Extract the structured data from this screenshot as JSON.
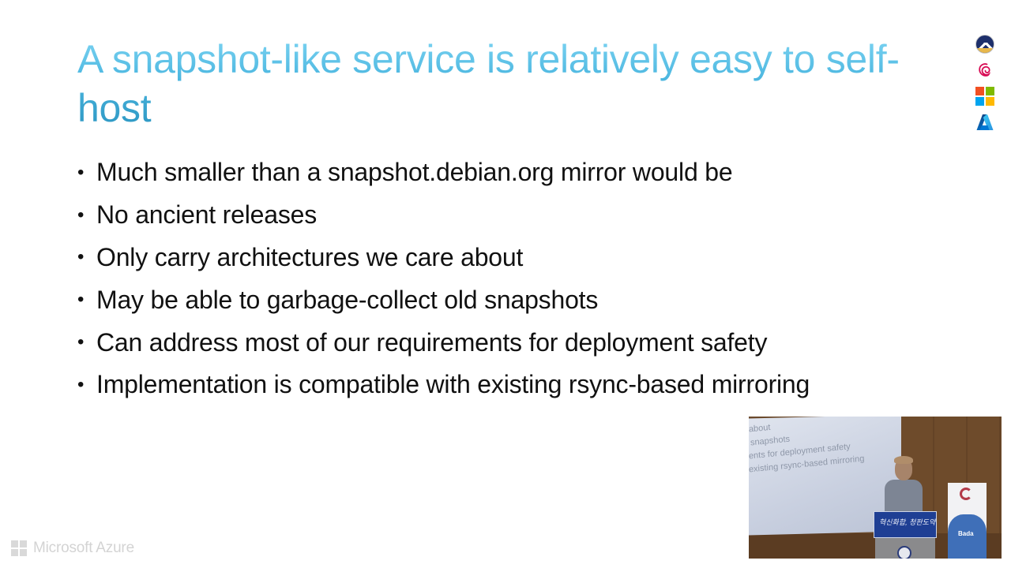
{
  "slide": {
    "title": "A snapshot-like service is relatively easy to self-host",
    "bullets": [
      "Much smaller than a snapshot.debian.org mirror would be",
      "No ancient releases",
      "Only carry architectures we care about",
      "May be able to garbage-collect old snapshots",
      "Can address most of our requirements for deployment safety",
      "Implementation is compatible with existing rsync-based mirroring"
    ],
    "bullet_glyph": "•"
  },
  "logos": [
    {
      "name": "debconf-logo"
    },
    {
      "name": "debian-swirl-logo",
      "color": "#d70a53"
    },
    {
      "name": "microsoft-logo",
      "colors": [
        "#f25022",
        "#7fba00",
        "#00a4ef",
        "#ffb900"
      ]
    },
    {
      "name": "azure-logo",
      "color": "#0078d4"
    }
  ],
  "webcam": {
    "screen_lines": [
      "about",
      "snapshots",
      "ents for deployment safety",
      "existing rsync-based mirroring"
    ],
    "podium_sign": "혁신화합, 청판도약",
    "banner_text": "Bada"
  },
  "watermark": {
    "text": "Microsoft Azure"
  },
  "colors": {
    "title_gradient_top": "#7fd5f3",
    "title_gradient_bottom": "#2a94c0",
    "body_text": "#111111"
  }
}
